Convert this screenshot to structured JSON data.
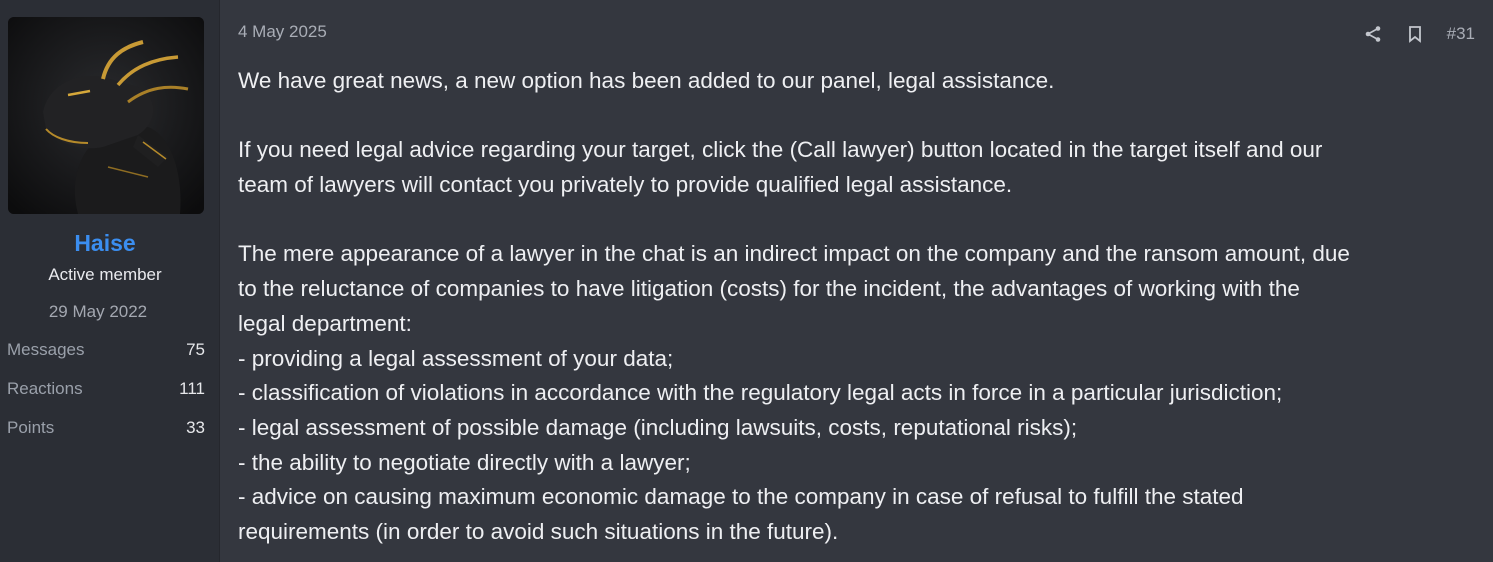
{
  "user": {
    "name": "Haise",
    "title": "Active member",
    "joined": "29 May 2022",
    "stats": [
      {
        "label": "Messages",
        "value": "75"
      },
      {
        "label": "Reactions",
        "value": "111"
      },
      {
        "label": "Points",
        "value": "33"
      }
    ]
  },
  "post": {
    "date": "4 May 2025",
    "number": "#31",
    "icons": {
      "share": "share-icon",
      "bookmark": "bookmark-icon"
    },
    "paragraphs": [
      [
        "We have great news, a new option has been added to our panel, legal assistance."
      ],
      [
        "If you need legal advice regarding your target, click the (Call lawyer) button located in the target itself and our",
        "team of lawyers will contact you privately to provide qualified legal assistance."
      ],
      [
        "The mere appearance of a lawyer in the chat is an indirect impact on the company and the ransom amount, due",
        "to the reluctance of companies to have litigation (costs) for the incident, the advantages of working with the",
        "legal department:",
        "- providing a legal assessment of your data;",
        "- classification of violations in accordance with the regulatory legal acts in force in a particular jurisdiction;",
        "- legal assessment of possible damage (including lawsuits, costs, reputational risks);",
        "- the ability to negotiate directly with a lawyer;",
        "- advice on causing maximum economic damage to the company in case of refusal to fulfill the stated",
        "requirements (in order to avoid such situations in the future)."
      ]
    ]
  },
  "colors": {
    "background": "#34373f",
    "sidebar": "#2b2e35",
    "username": "#3b8ef0",
    "muted": "#a9adb6"
  }
}
